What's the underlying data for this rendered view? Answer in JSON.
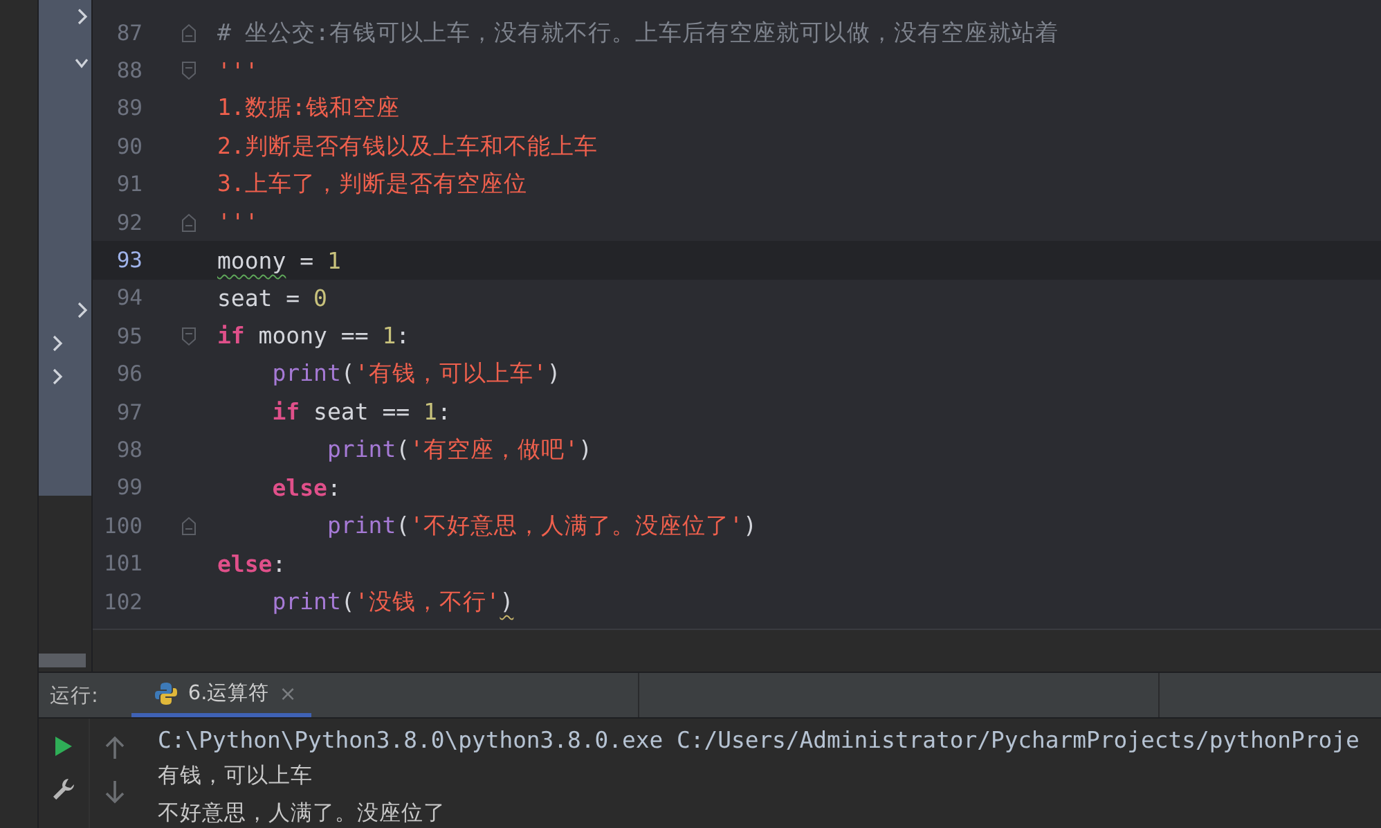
{
  "editor": {
    "lines": [
      {
        "number": "87",
        "fold_start": false,
        "fold_end": true,
        "current": false,
        "tokens": [
          {
            "kind": "comment",
            "text": "# 坐公交:有钱可以上车，没有就不行。上车后有空座就可以做，没有空座就站着"
          }
        ]
      },
      {
        "number": "88",
        "fold_start": true,
        "fold_end": false,
        "current": false,
        "tokens": [
          {
            "kind": "doc",
            "text": "'''"
          }
        ]
      },
      {
        "number": "89",
        "fold_start": false,
        "fold_end": false,
        "current": false,
        "tokens": [
          {
            "kind": "doc",
            "text": "1.数据:钱和空座"
          }
        ]
      },
      {
        "number": "90",
        "fold_start": false,
        "fold_end": false,
        "current": false,
        "tokens": [
          {
            "kind": "doc",
            "text": "2.判断是否有钱以及上车和不能上车"
          }
        ]
      },
      {
        "number": "91",
        "fold_start": false,
        "fold_end": false,
        "current": false,
        "tokens": [
          {
            "kind": "doc",
            "text": "3.上车了，判断是否有空座位"
          }
        ]
      },
      {
        "number": "92",
        "fold_start": false,
        "fold_end": true,
        "current": false,
        "tokens": [
          {
            "kind": "doc",
            "text": "'''"
          }
        ]
      },
      {
        "number": "93",
        "fold_start": false,
        "fold_end": false,
        "current": true,
        "tokens": [
          {
            "kind": "ident",
            "text": "moony",
            "typo": true
          },
          {
            "kind": "ident",
            "text": " = "
          },
          {
            "kind": "number",
            "text": "1"
          }
        ]
      },
      {
        "number": "94",
        "fold_start": false,
        "fold_end": false,
        "current": false,
        "tokens": [
          {
            "kind": "ident",
            "text": "seat = "
          },
          {
            "kind": "number",
            "text": "0"
          }
        ]
      },
      {
        "number": "95",
        "fold_start": true,
        "fold_end": false,
        "current": false,
        "tokens": [
          {
            "kind": "keyword",
            "text": "if"
          },
          {
            "kind": "ident",
            "text": " moony == "
          },
          {
            "kind": "number",
            "text": "1"
          },
          {
            "kind": "ident",
            "text": ":"
          }
        ]
      },
      {
        "number": "96",
        "fold_start": false,
        "fold_end": false,
        "current": false,
        "tokens": [
          {
            "kind": "func",
            "text": "    print"
          },
          {
            "kind": "ident",
            "text": "("
          },
          {
            "kind": "string",
            "text": "'有钱，可以上车'"
          },
          {
            "kind": "ident",
            "text": ")"
          }
        ]
      },
      {
        "number": "97",
        "fold_start": false,
        "fold_end": false,
        "current": false,
        "tokens": [
          {
            "kind": "keyword",
            "text": "    if"
          },
          {
            "kind": "ident",
            "text": " seat == "
          },
          {
            "kind": "number",
            "text": "1"
          },
          {
            "kind": "ident",
            "text": ":"
          }
        ]
      },
      {
        "number": "98",
        "fold_start": false,
        "fold_end": false,
        "current": false,
        "tokens": [
          {
            "kind": "func",
            "text": "        print"
          },
          {
            "kind": "ident",
            "text": "("
          },
          {
            "kind": "string",
            "text": "'有空座，做吧'"
          },
          {
            "kind": "ident",
            "text": ")"
          }
        ]
      },
      {
        "number": "99",
        "fold_start": false,
        "fold_end": false,
        "current": false,
        "tokens": [
          {
            "kind": "keyword",
            "text": "    else"
          },
          {
            "kind": "ident",
            "text": ":"
          }
        ]
      },
      {
        "number": "100",
        "fold_start": false,
        "fold_end": true,
        "current": false,
        "tokens": [
          {
            "kind": "func",
            "text": "        print"
          },
          {
            "kind": "ident",
            "text": "("
          },
          {
            "kind": "string",
            "text": "'不好意思，人满了。没座位了'"
          },
          {
            "kind": "ident",
            "text": ")"
          }
        ]
      },
      {
        "number": "101",
        "fold_start": false,
        "fold_end": false,
        "current": false,
        "tokens": [
          {
            "kind": "keyword",
            "text": "else"
          },
          {
            "kind": "ident",
            "text": ":"
          }
        ]
      },
      {
        "number": "102",
        "fold_start": false,
        "fold_end": false,
        "current": false,
        "tokens": [
          {
            "kind": "func",
            "text": "    print"
          },
          {
            "kind": "ident",
            "text": "("
          },
          {
            "kind": "string",
            "text": "'没钱，不行'"
          },
          {
            "kind": "ident",
            "text": ")",
            "warning": true
          }
        ]
      }
    ]
  },
  "run_panel": {
    "label": "运行:",
    "tabs": [
      {
        "label": "6.运算符",
        "close": "×",
        "selected": true
      }
    ],
    "console": [
      {
        "kind": "command",
        "text": "C:\\Python\\Python3.8.0\\python3.8.0.exe C:/Users/Administrator/PycharmProjects/pythonProje"
      },
      {
        "kind": "output",
        "text": "有钱，可以上车"
      },
      {
        "kind": "output",
        "text": "不好意思，人满了。没座位了"
      }
    ]
  }
}
